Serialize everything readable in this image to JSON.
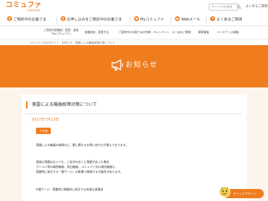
{
  "brand": {
    "logo_text": "コミュファ",
    "logo_sub": "commufa",
    "accent_color": "#ef7d1e",
    "content_bg": "#fdf5ec"
  },
  "header": {
    "search_placeholder": "サイト内を検索",
    "faq_label": "よくあるご質問"
  },
  "mainnav": {
    "items": [
      {
        "label": "ご契約中のお客さま",
        "icon": "person-icon"
      },
      {
        "label": "お申し込みをご検討中のお客さま",
        "icon": "person-icon"
      },
      {
        "label": "Myコミュファ",
        "icon": "heart-icon"
      },
      {
        "label": "Webメール",
        "icon": "mail-icon"
      },
      {
        "label": "よくあるご質問",
        "icon": "question-icon"
      }
    ]
  },
  "subnav": {
    "items": [
      {
        "line1": "ご契約内容確認・変更・追加",
        "line2": "「Myコミュファ」"
      },
      {
        "line1": "各種追加・変更方法",
        "line2": ""
      },
      {
        "line1": "ご契約中のお客さまの特典・キャンペーン",
        "line2": ""
      },
      {
        "line1": "よくあるご質問",
        "line2": ""
      },
      {
        "line1": "障害情報",
        "line2": ""
      },
      {
        "line1": "メンテナンス情報",
        "line2": ""
      }
    ]
  },
  "breadcrumb": "コミュファ光公式サイト　お知らせ　落雷による機器故障対策について",
  "banner": {
    "title": "お知らせ"
  },
  "article": {
    "title": "落雷による機器故障対策について",
    "date": "2017年7月13日",
    "badge": "その他",
    "paragraphs": [
      "落雷による機器の故障など、雷に関するお問い合わせが増えております。",
      "直接の落雷はなくても、ご自宅の近くに落雷があった場合、",
      "パソコン等の精密機器、周辺機器、コミュファ光の通信機器も、",
      "落雷時に発生する「雷サージ」の影響で故障する可能性があります。",
      "※雷サージ：落雷時に瞬間的に発生する有害な過電流"
    ]
  },
  "support_widget": {
    "label": "チャットサポート"
  }
}
